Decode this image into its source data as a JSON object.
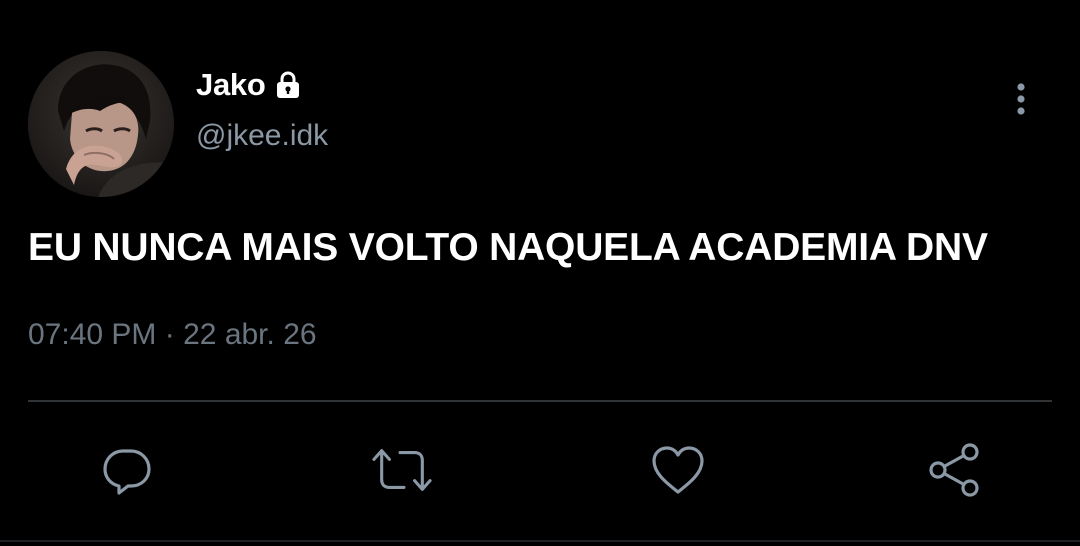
{
  "profile": {
    "display_name": "Jako",
    "handle": "@jkee.idk",
    "protected_icon": "lock-icon",
    "avatar": "avatar-photo"
  },
  "tweet": {
    "text": "EU NUNCA MAIS VOLTO NAQUELA ACADEMIA DNV",
    "time": "07:40 PM",
    "separator": "·",
    "date": "22 abr. 26"
  },
  "actions": {
    "more": "more-vertical-icon",
    "reply": "reply-icon",
    "retweet": "retweet-icon",
    "like": "heart-icon",
    "share": "share-icon"
  },
  "colors": {
    "background": "#000000",
    "text": "#ffffff",
    "secondary": "#8b98a5",
    "meta": "#6b7580",
    "icon": "#8b98a5",
    "divider": "#2f3336"
  }
}
